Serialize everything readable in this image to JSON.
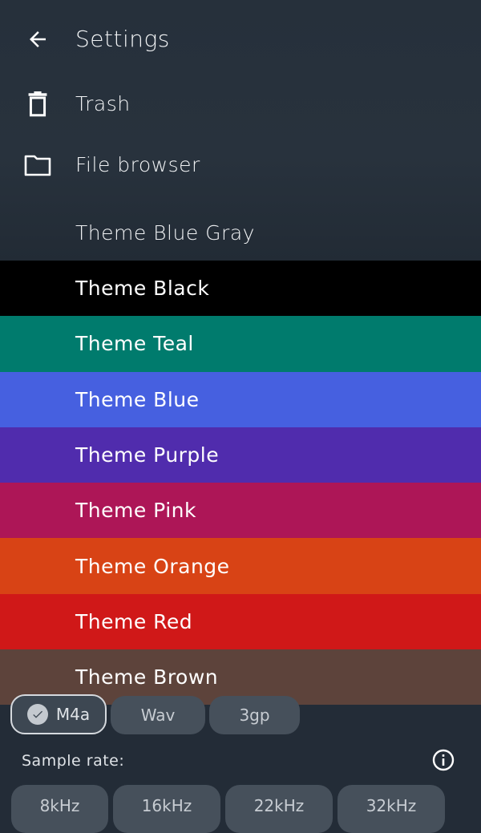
{
  "header": {
    "title": "Settings",
    "items": [
      {
        "label": "Trash",
        "icon": "trash-icon"
      },
      {
        "label": "File browser",
        "icon": "folder-icon"
      }
    ]
  },
  "themes": [
    {
      "label": "Theme Blue Gray",
      "color": "#232c37"
    },
    {
      "label": "Theme Black",
      "color": "#000000"
    },
    {
      "label": "Theme Teal",
      "color": "#007b6d"
    },
    {
      "label": "Theme Blue",
      "color": "#4660e0"
    },
    {
      "label": "Theme Purple",
      "color": "#502cad"
    },
    {
      "label": "Theme Pink",
      "color": "#ad1657"
    },
    {
      "label": "Theme Orange",
      "color": "#d84315"
    },
    {
      "label": "Theme Red",
      "color": "#d01818"
    },
    {
      "label": "Theme Brown",
      "color": "#5d433b"
    }
  ],
  "format": {
    "options": [
      {
        "label": "M4a",
        "selected": true
      },
      {
        "label": "Wav",
        "selected": false
      },
      {
        "label": "3gp",
        "selected": false
      }
    ]
  },
  "sample_rate": {
    "label": "Sample rate:",
    "options": [
      "8kHz",
      "16kHz",
      "22kHz",
      "32kHz"
    ]
  }
}
